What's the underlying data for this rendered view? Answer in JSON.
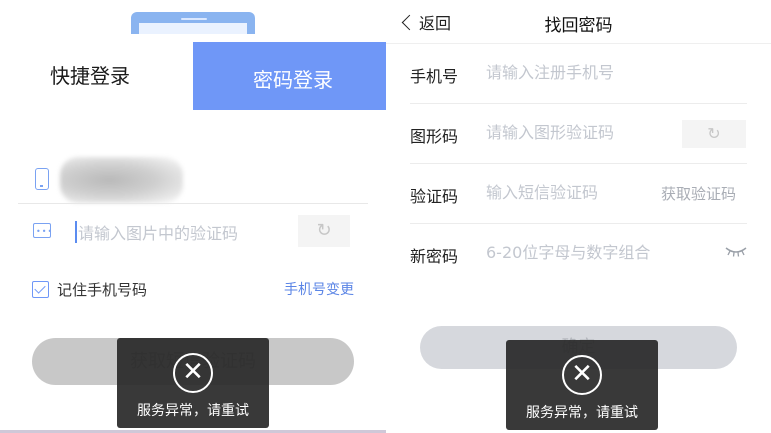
{
  "left": {
    "tabs": {
      "quick_login": "快捷登录",
      "password_login": "密码登录"
    },
    "captcha": {
      "placeholder": "请输入图片中的验证码"
    },
    "remember_label": "记住手机号码",
    "change_phone_link": "手机号变更",
    "get_code_button": "获取短信验证码",
    "icons": {
      "phone": "phone-icon",
      "captcha": "keyboard-icon",
      "refresh": "refresh-icon",
      "checkbox": "checkbox-checked-icon"
    },
    "colors": {
      "accent": "#6f97f7",
      "link": "#5b85e6"
    }
  },
  "right": {
    "nav": {
      "back_label": "返回",
      "title": "找回密码"
    },
    "fields": {
      "phone": {
        "label": "手机号",
        "placeholder": "请输入注册手机号"
      },
      "image_code": {
        "label": "图形码",
        "placeholder": "请输入图形验证码"
      },
      "sms_code": {
        "label": "验证码",
        "placeholder": "输入短信验证码",
        "action": "获取验证码"
      },
      "new_password": {
        "label": "新密码",
        "placeholder": "6-20位字母与数字组合"
      }
    },
    "confirm_button": "确定",
    "icons": {
      "back": "chevron-left-icon",
      "refresh": "refresh-icon",
      "eye": "eye-closed-icon"
    }
  },
  "toast": {
    "message": "服务异常，请重试",
    "icon": "close-circle-icon"
  }
}
